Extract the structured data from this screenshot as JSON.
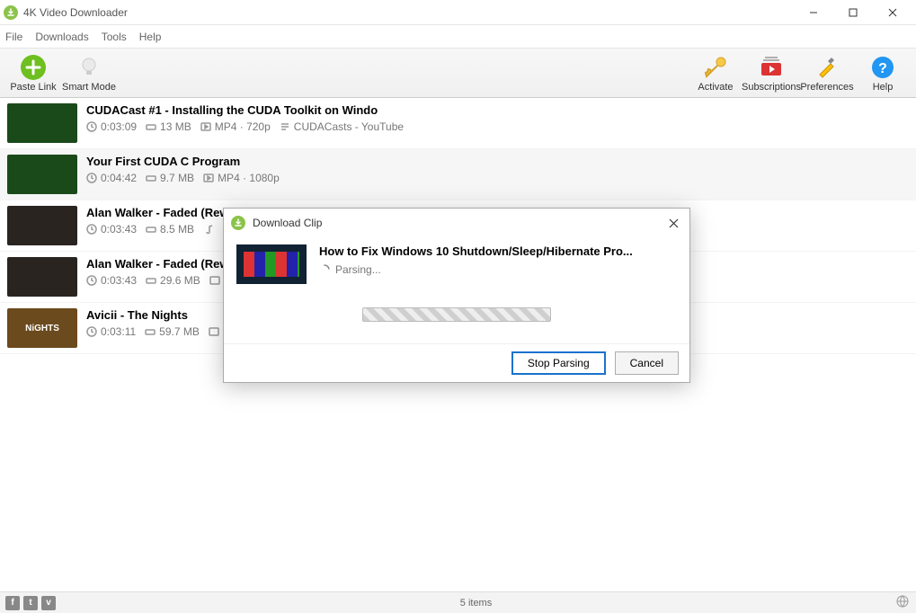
{
  "window": {
    "title": "4K Video Downloader"
  },
  "menu": {
    "file": "File",
    "downloads": "Downloads",
    "tools": "Tools",
    "help": "Help"
  },
  "toolbar": {
    "paste": "Paste Link",
    "smart": "Smart Mode",
    "activate": "Activate",
    "subs": "Subscriptions",
    "prefs": "Preferences",
    "help": "Help"
  },
  "items": [
    {
      "title": "CUDACast #1 - Installing the CUDA Toolkit on Windo",
      "duration": "0:03:09",
      "size": "13 MB",
      "format": "MP4 · 720p",
      "channel": "CUDACasts - YouTube"
    },
    {
      "title": "Your First CUDA C Program",
      "duration": "0:04:42",
      "size": "9.7 MB",
      "format": "MP4 · 1080p",
      "channel": ""
    },
    {
      "title": "Alan Walker - Faded (Rewo",
      "duration": "0:03:43",
      "size": "8.5 MB",
      "format": "",
      "channel": ""
    },
    {
      "title": "Alan Walker - Faded (Rewo",
      "duration": "0:03:43",
      "size": "29.6 MB",
      "format": "",
      "channel": ""
    },
    {
      "title": "Avicii - The Nights",
      "duration": "0:03:11",
      "size": "59.7 MB",
      "format": "",
      "channel": ""
    }
  ],
  "dialog": {
    "title": "Download Clip",
    "clip_title": "How to Fix Windows 10 Shutdown/Sleep/Hibernate Pro...",
    "status": "Parsing...",
    "stop": "Stop Parsing",
    "cancel": "Cancel"
  },
  "status": {
    "count": "5 items"
  }
}
